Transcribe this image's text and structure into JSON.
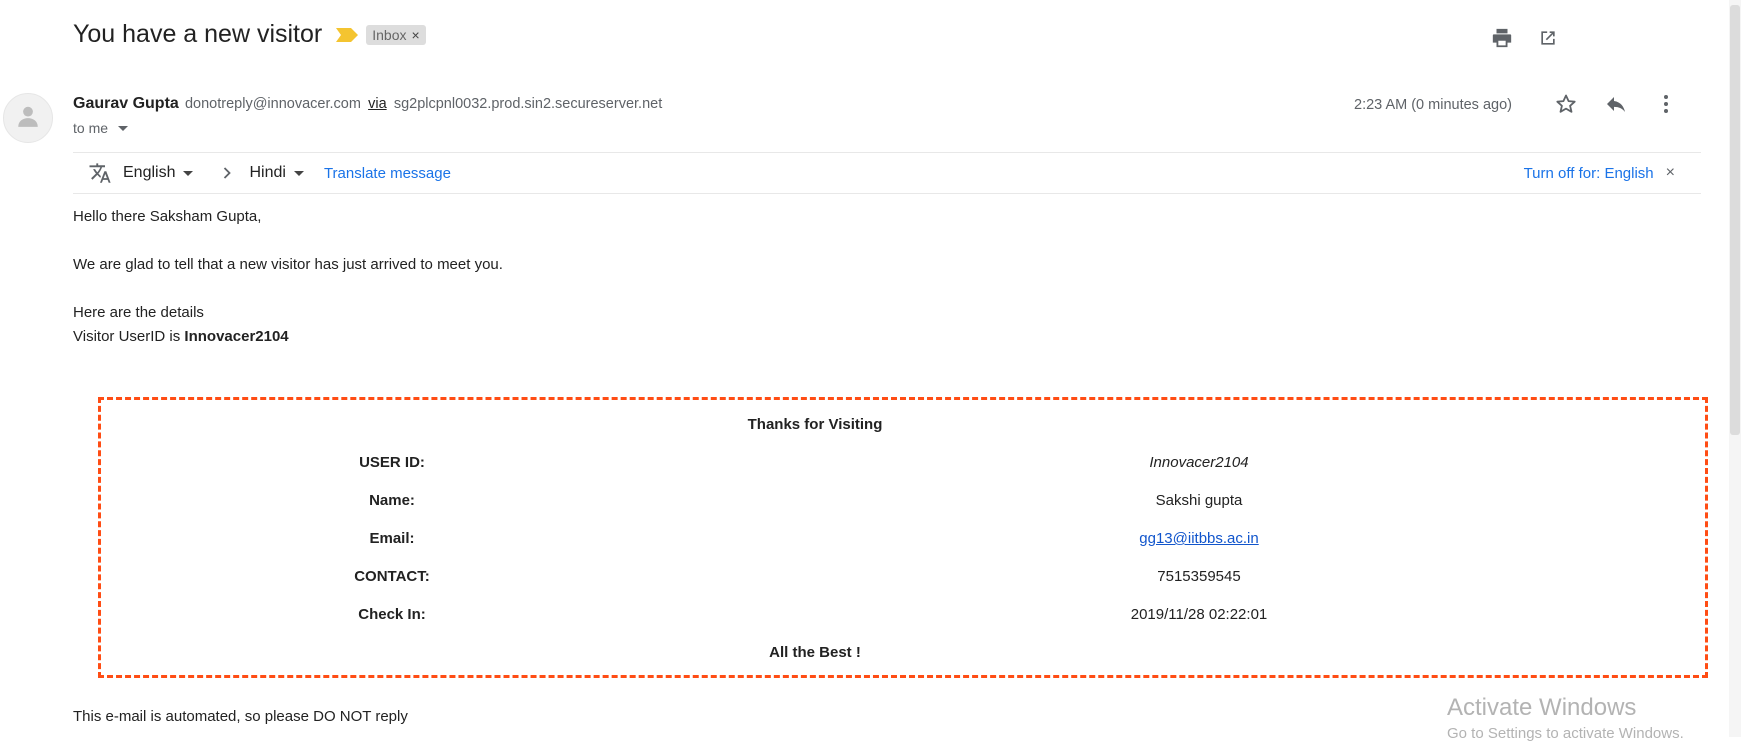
{
  "header": {
    "subject": "You have a new visitor",
    "label": "Inbox",
    "label_remove": "×",
    "important_color": "#f4c430"
  },
  "sender": {
    "name": "Gaurav Gupta",
    "email": "donotreply@innovacer.com",
    "via_label": "via",
    "via_server": "sg2plcpnl0032.prod.sin2.secureserver.net",
    "to": "to me",
    "timestamp": "2:23 AM (0 minutes ago)"
  },
  "translate": {
    "from_lang": "English",
    "to_lang": "Hindi",
    "translate_label": "Translate message",
    "turn_off_label": "Turn off for: English",
    "close": "×"
  },
  "message": {
    "greeting": "Hello there Saksham Gupta,",
    "intro": "We are glad to tell that a new visitor has just arrived to meet you.",
    "details_heading": "Here are the details",
    "visitor_id_prefix": "Visitor UserID is ",
    "visitor_id": "Innovacer2104",
    "card": {
      "title": "Thanks for Visiting",
      "rows": [
        {
          "label": "USER ID:",
          "value": "Innovacer2104"
        },
        {
          "label": "Name:",
          "value": "Sakshi gupta"
        },
        {
          "label": "Email:",
          "value": "gg13@iitbbs.ac.in"
        },
        {
          "label": "CONTACT:",
          "value": "7515359545"
        },
        {
          "label": "Check In:",
          "value": "2019/11/28 02:22:01"
        }
      ],
      "footer": "All the Best !",
      "border_color": "#ff4d14"
    },
    "footer_note": "This e-mail is automated, so please DO NOT reply"
  },
  "watermark": {
    "line1": "Activate Windows",
    "line2": "Go to Settings to activate Windows."
  },
  "icons": [
    "print-icon",
    "open-in-new-window-icon",
    "star-icon",
    "reply-icon",
    "more-vert-icon",
    "translate-icon",
    "chevron-right-icon",
    "person-icon"
  ]
}
